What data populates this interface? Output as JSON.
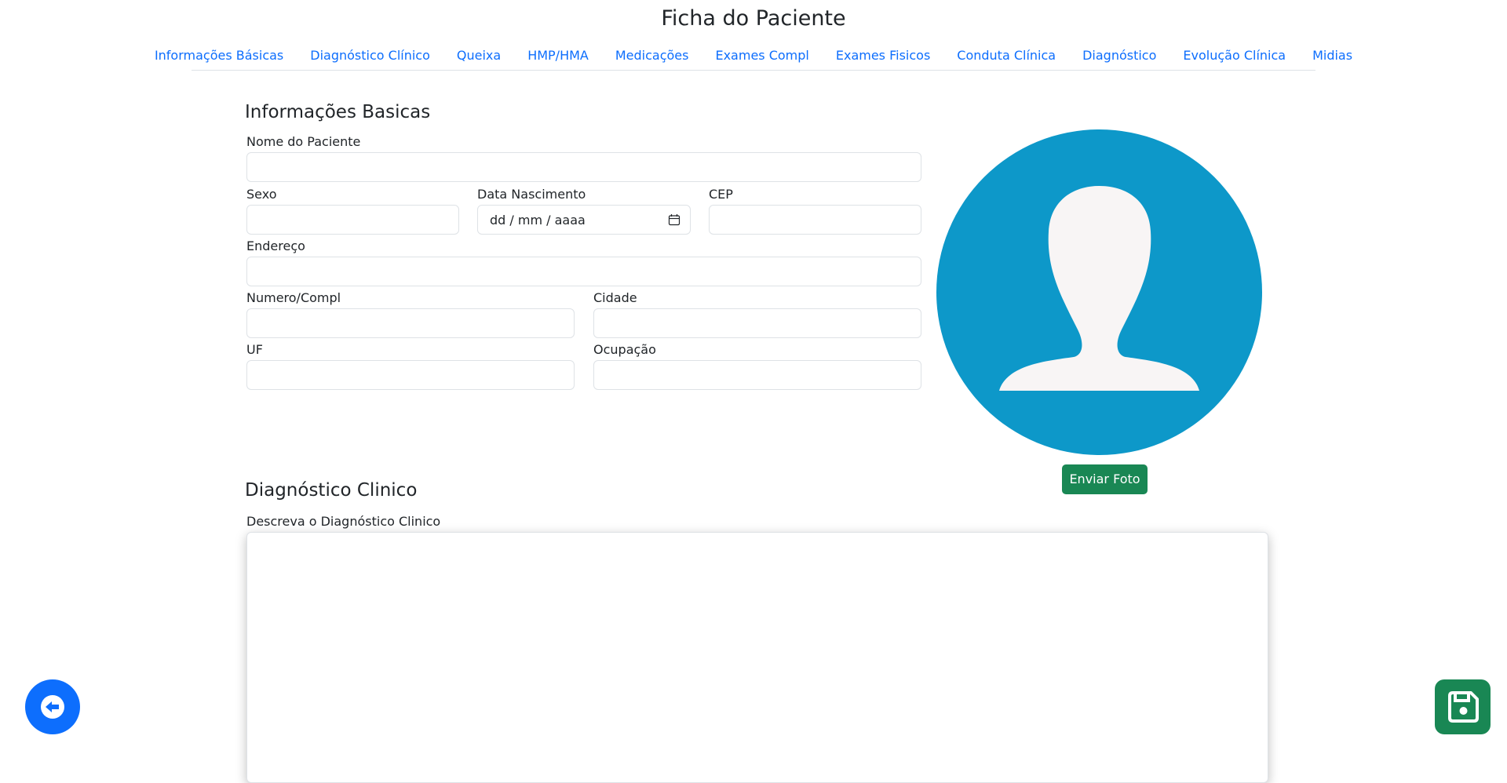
{
  "page": {
    "title": "Ficha do Paciente"
  },
  "nav": {
    "tabs": [
      "Informações Básicas",
      "Diagnóstico Clínico",
      "Queixa",
      "HMP/HMA",
      "Medicações",
      "Exames Compl",
      "Exames Fisicos",
      "Conduta Clínica",
      "Diagnóstico",
      "Evolução Clínica",
      "Midias"
    ]
  },
  "basic_info": {
    "title": "Informações Basicas",
    "fields": {
      "name": {
        "label": "Nome do Paciente",
        "value": ""
      },
      "sex": {
        "label": "Sexo",
        "value": ""
      },
      "birth_date": {
        "label": "Data Nascimento",
        "placeholder": "dd / mm / aaaa"
      },
      "cep": {
        "label": "CEP",
        "value": ""
      },
      "address": {
        "label": "Endereço",
        "value": ""
      },
      "number": {
        "label": "Numero/Compl",
        "value": ""
      },
      "city": {
        "label": "Cidade",
        "value": ""
      },
      "uf": {
        "label": "UF",
        "value": ""
      },
      "occupation": {
        "label": "Ocupação",
        "value": ""
      }
    }
  },
  "photo": {
    "button_label": "Enviar Foto",
    "circle_color": "#0d98c9",
    "silhouette_color": "#f8f5f5"
  },
  "diagnosis": {
    "title": "Diagnóstico Clinico",
    "label": "Descreva o Diagnóstico Clinico",
    "value": ""
  },
  "actions": {
    "back_icon": "arrow-left-circle-icon",
    "save_icon": "floppy-disk-icon",
    "back_color": "#0d6efd",
    "save_color": "#198754"
  }
}
